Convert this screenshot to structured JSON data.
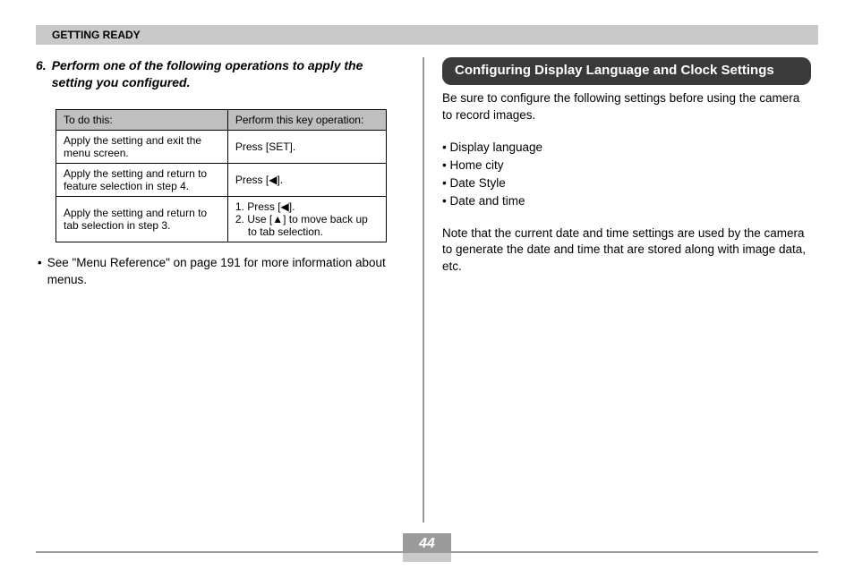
{
  "header": "GETTING READY",
  "step": {
    "num": "6.",
    "text": "Perform one of the following operations to apply the setting you configured."
  },
  "table": {
    "col1": "To do this:",
    "col2": "Perform this key operation:",
    "rows": [
      {
        "action": "Apply the setting and exit the menu screen.",
        "op": "Press [SET]."
      },
      {
        "action": "Apply the setting and return to feature selection in step 4.",
        "op": "Press [◀]."
      },
      {
        "action": "Apply the setting and return to tab selection in step 3.",
        "op1": "1. Press [◀].",
        "op2": "2. Use [▲] to move back up to tab selection."
      }
    ]
  },
  "left_note": "See \"Menu Reference\" on page 191 for more information about menus.",
  "right": {
    "title": "Configuring Display Language and Clock Settings",
    "intro": "Be sure to configure the following settings before using the camera to record images.",
    "items": [
      "Display language",
      "Home city",
      "Date Style",
      "Date and time"
    ],
    "note": "Note that the current date and time settings are used by the camera to generate the date and time that are stored along with image data, etc."
  },
  "page_number": "44"
}
